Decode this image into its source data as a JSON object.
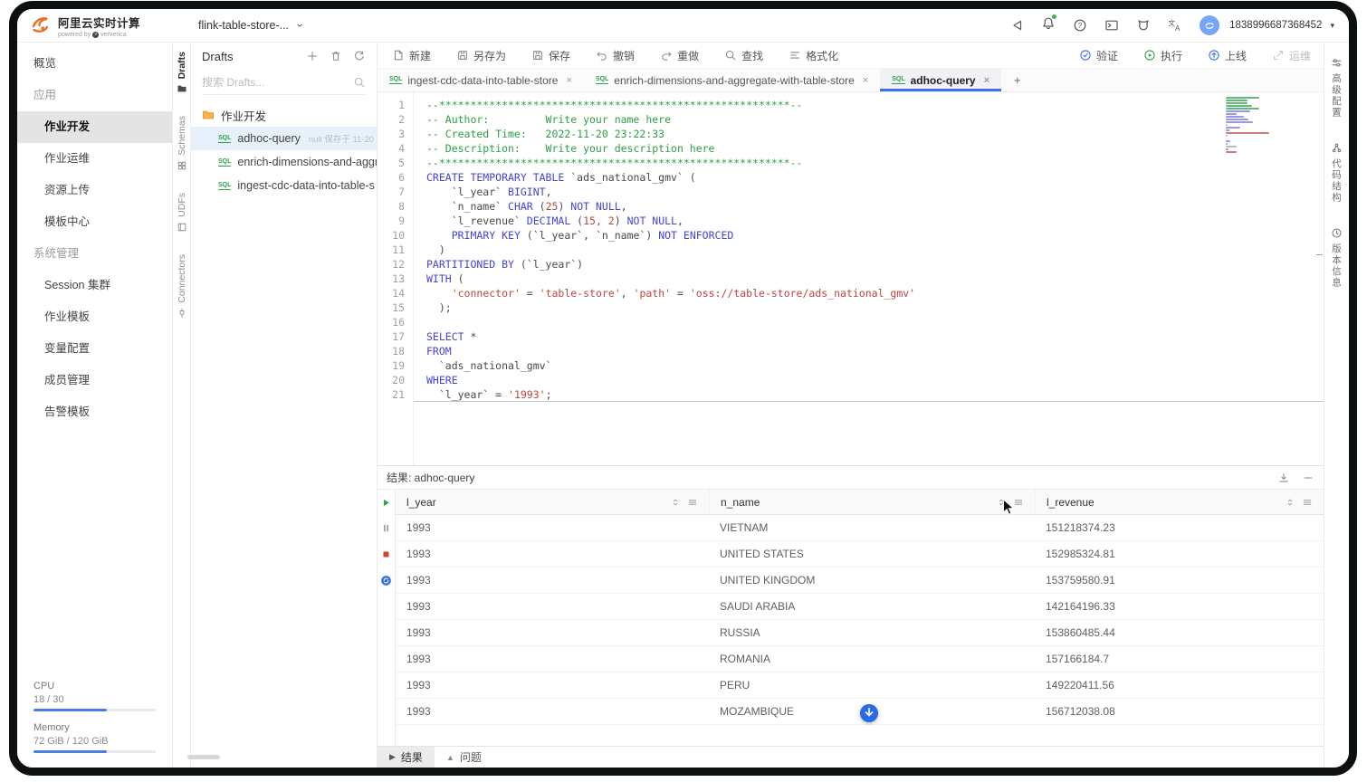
{
  "topbar": {
    "product_title": "阿里云实时计算",
    "powered_by": "powered by",
    "brand": "ververica",
    "workspace": "flink-table-store-...",
    "user_id": "1838996687368452"
  },
  "sidebar": {
    "items": [
      {
        "label": "概览",
        "type": "item"
      },
      {
        "label": "应用",
        "type": "section"
      },
      {
        "label": "作业开发",
        "type": "child active"
      },
      {
        "label": "作业运维",
        "type": "child"
      },
      {
        "label": "资源上传",
        "type": "child"
      },
      {
        "label": "模板中心",
        "type": "child"
      },
      {
        "label": "系统管理",
        "type": "section"
      },
      {
        "label": "Session 集群",
        "type": "child"
      },
      {
        "label": "作业模板",
        "type": "child"
      },
      {
        "label": "变量配置",
        "type": "child"
      },
      {
        "label": "成员管理",
        "type": "child"
      },
      {
        "label": "告警模板",
        "type": "child"
      }
    ],
    "cpu_label": "CPU",
    "cpu_value": "18 / 30",
    "cpu_percent": 60,
    "memory_label": "Memory",
    "memory_value": "72 GiB / 120 GiB",
    "memory_percent": 60
  },
  "left_rail": {
    "tabs": [
      {
        "label": "Drafts",
        "icon": "folderdark",
        "active": true
      },
      {
        "label": "Schemas",
        "icon": "grid",
        "active": false
      },
      {
        "label": "UDFs",
        "icon": "book",
        "active": false
      },
      {
        "label": "Connectors",
        "icon": "plug",
        "active": false
      }
    ]
  },
  "drafts_panel": {
    "title": "Drafts",
    "search_placeholder": "搜索 Drafts...",
    "folder": "作业开发",
    "items": [
      {
        "name": "adhoc-query",
        "meta": "null 保存于 11-20",
        "selected": true
      },
      {
        "name": "enrich-dimensions-and-aggr",
        "meta": "",
        "selected": false
      },
      {
        "name": "ingest-cdc-data-into-table-s",
        "meta": "",
        "selected": false
      }
    ]
  },
  "toolbar": {
    "left": [
      {
        "label": "新建",
        "icon": "doc-new"
      },
      {
        "label": "另存为",
        "icon": "save-as"
      },
      {
        "label": "保存",
        "icon": "save"
      },
      {
        "label": "撤销",
        "icon": "undo"
      },
      {
        "label": "重做",
        "icon": "redo"
      },
      {
        "label": "查找",
        "icon": "search"
      },
      {
        "label": "格式化",
        "icon": "format"
      }
    ],
    "right": [
      {
        "label": "验证",
        "icon": "validate",
        "color": "#3b6ef5",
        "disabled": false
      },
      {
        "label": "执行",
        "icon": "run",
        "color": "#2ba245",
        "disabled": false
      },
      {
        "label": "上线",
        "icon": "deploy",
        "color": "#3b6ef5",
        "disabled": false
      },
      {
        "label": "运维",
        "icon": "ops",
        "color": "#c2c2c2",
        "disabled": true
      }
    ]
  },
  "editor_tabs": [
    {
      "label": "ingest-cdc-data-into-table-store",
      "active": false
    },
    {
      "label": "enrich-dimensions-and-aggregate-with-table-store",
      "active": false
    },
    {
      "label": "adhoc-query",
      "active": true
    }
  ],
  "editor": {
    "lines": [
      [
        [
          "c",
          "--********************************************************--"
        ]
      ],
      [
        [
          "c",
          "-- Author:         Write your name here"
        ]
      ],
      [
        [
          "c",
          "-- Created Time:   2022-11-20 23:22:33"
        ]
      ],
      [
        [
          "c",
          "-- Description:    Write your description here"
        ]
      ],
      [
        [
          "c",
          "--********************************************************--"
        ]
      ],
      [
        [
          "k",
          "CREATE TEMPORARY TABLE"
        ],
        [
          "p",
          " `ads_national_gmv` ("
        ]
      ],
      [
        [
          "p",
          "    `l_year` "
        ],
        [
          "k",
          "BIGINT"
        ],
        [
          "p",
          ","
        ]
      ],
      [
        [
          "p",
          "    `n_name` "
        ],
        [
          "k",
          "CHAR"
        ],
        [
          "p",
          " ("
        ],
        [
          "n",
          "25"
        ],
        [
          "p",
          ") "
        ],
        [
          "k",
          "NOT NULL"
        ],
        [
          "p",
          ","
        ]
      ],
      [
        [
          "p",
          "    `l_revenue` "
        ],
        [
          "k",
          "DECIMAL"
        ],
        [
          "p",
          " ("
        ],
        [
          "n",
          "15, 2"
        ],
        [
          "p",
          ") "
        ],
        [
          "k",
          "NOT NULL"
        ],
        [
          "p",
          ","
        ]
      ],
      [
        [
          "p",
          "    "
        ],
        [
          "k",
          "PRIMARY KEY"
        ],
        [
          "p",
          " (`l_year`, `n_name`) "
        ],
        [
          "k",
          "NOT ENFORCED"
        ]
      ],
      [
        [
          "p",
          "  )"
        ]
      ],
      [
        [
          "k",
          "PARTITIONED BY"
        ],
        [
          "p",
          " (`l_year`)"
        ]
      ],
      [
        [
          "k",
          "WITH"
        ],
        [
          "p",
          " ("
        ]
      ],
      [
        [
          "p",
          "    "
        ],
        [
          "s",
          "'connector'"
        ],
        [
          "p",
          " = "
        ],
        [
          "s",
          "'table-store'"
        ],
        [
          "p",
          ", "
        ],
        [
          "s",
          "'path'"
        ],
        [
          "p",
          " = "
        ],
        [
          "s",
          "'oss://table-store/ads_national_gmv'"
        ]
      ],
      [
        [
          "p",
          "  );"
        ]
      ],
      [],
      [
        [
          "k",
          "SELECT"
        ],
        [
          "p",
          " *"
        ]
      ],
      [
        [
          "k",
          "FROM"
        ]
      ],
      [
        [
          "p",
          "  `ads_national_gmv`"
        ]
      ],
      [
        [
          "k",
          "WHERE"
        ]
      ],
      [
        [
          "p",
          "  `l_year` = "
        ],
        [
          "s",
          "'1993'"
        ],
        [
          "p",
          ";"
        ]
      ]
    ]
  },
  "right_rail": {
    "tabs": [
      {
        "label": "高级配置",
        "icon": "sliders"
      },
      {
        "label": "代码结构",
        "icon": "struct"
      },
      {
        "label": "版本信息",
        "icon": "clock"
      }
    ]
  },
  "results": {
    "title": "结果: adhoc-query",
    "columns": [
      "l_year",
      "n_name",
      "l_revenue"
    ],
    "rows": [
      [
        "1993",
        "VIETNAM",
        "151218374.23"
      ],
      [
        "1993",
        "UNITED STATES",
        "152985324.81"
      ],
      [
        "1993",
        "UNITED KINGDOM",
        "153759580.91"
      ],
      [
        "1993",
        "SAUDI ARABIA",
        "142164196.33"
      ],
      [
        "1993",
        "RUSSIA",
        "153860485.44"
      ],
      [
        "1993",
        "ROMANIA",
        "157166184.7"
      ],
      [
        "1993",
        "PERU",
        "149220411.56"
      ],
      [
        "1993",
        "MOZAMBIQUE",
        "156712038.08"
      ]
    ],
    "bottom_tabs": [
      {
        "label": "结果",
        "glyph": "▶",
        "active": true
      },
      {
        "label": "问题",
        "glyph": "▲",
        "active": false
      }
    ]
  },
  "colors": {
    "accent": "#3b6ef5",
    "green": "#2ba245",
    "red": "#cf4436",
    "comment": "#2f9e44",
    "keyword": "#4743d2",
    "string": "#c0453c",
    "number": "#b04a3e"
  }
}
